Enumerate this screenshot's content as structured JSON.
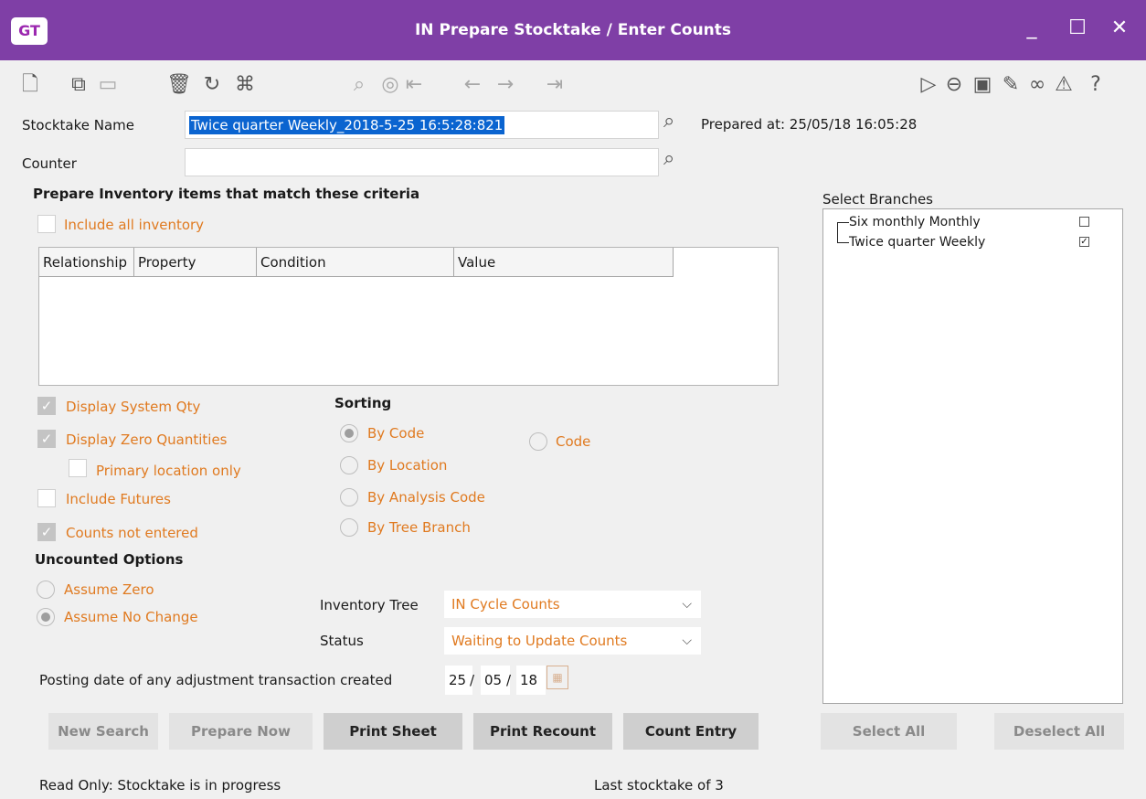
{
  "window": {
    "logo": "GT",
    "title": "IN Prepare Stocktake / Enter Counts",
    "minimize": "_",
    "maximize": "☐",
    "close": "✕"
  },
  "toolbar": {
    "left_icons": [
      "new-document-icon",
      "copy-icon",
      "save-icon",
      "delete-icon",
      "refresh-icon",
      "hierarchy-icon"
    ],
    "nav_icons": [
      "find-icon",
      "go-to-icon",
      "first-icon",
      "previous-icon",
      "next-icon",
      "last-icon"
    ],
    "right_icons": [
      "run-icon",
      "back-icon",
      "notes-icon",
      "attach-icon",
      "link-icon",
      "alert-icon",
      "help-icon"
    ]
  },
  "form": {
    "stocktake_name_label": "Stocktake Name",
    "stocktake_name_value": "Twice quarter Weekly_2018-5-25 16:5:28:821",
    "prepared_at": "Prepared at: 25/05/18 16:05:28",
    "counter_label": "Counter",
    "counter_value": ""
  },
  "criteria": {
    "heading": "Prepare Inventory items that match these criteria",
    "include_all_label": "Include all inventory",
    "include_all_checked": false,
    "columns": [
      "Relationship",
      "Property",
      "Condition",
      "Value"
    ],
    "rows": []
  },
  "options": {
    "display_system_qty": {
      "label": "Display System Qty",
      "checked": true
    },
    "display_zero_quantities": {
      "label": "Display Zero Quantities",
      "checked": true
    },
    "primary_location_only": {
      "label": "Primary location only",
      "checked": false
    },
    "include_futures": {
      "label": "Include Futures",
      "checked": false
    },
    "counts_not_entered": {
      "label": "Counts not entered",
      "checked": true
    }
  },
  "sorting": {
    "heading": "Sorting",
    "options": [
      "By Code",
      "By Location",
      "By Analysis Code",
      "By Tree Branch"
    ],
    "selected": "By Code",
    "secondary": "Code"
  },
  "uncounted": {
    "heading": "Uncounted Options",
    "options": [
      "Assume Zero",
      "Assume No Change"
    ],
    "selected": "Assume No Change"
  },
  "inventory_tree": {
    "label": "Inventory Tree",
    "value": "IN Cycle Counts"
  },
  "status": {
    "label": "Status",
    "value": "Waiting to Update Counts"
  },
  "posting_date": {
    "label": "Posting date of any adjustment transaction created",
    "day": "25",
    "month": "05",
    "year": "18",
    "sep": "/"
  },
  "branches": {
    "heading": "Select Branches",
    "items": [
      {
        "label": "Six monthly Monthly",
        "checked": false
      },
      {
        "label": "Twice quarter Weekly",
        "checked": true
      }
    ],
    "select_all": "Select All",
    "deselect_all": "Deselect All"
  },
  "buttons": {
    "new_search": "New Search",
    "prepare_now": "Prepare Now",
    "print_sheet": "Print Sheet",
    "print_recount": "Print Recount",
    "count_entry": "Count Entry"
  },
  "statusbar": {
    "left": "Read Only: Stocktake is in progress",
    "right": "Last stocktake of 3"
  },
  "colors": {
    "titlebar": "#7f3fa6",
    "accent_text": "#e07a20",
    "selection": "#0a64d0"
  }
}
